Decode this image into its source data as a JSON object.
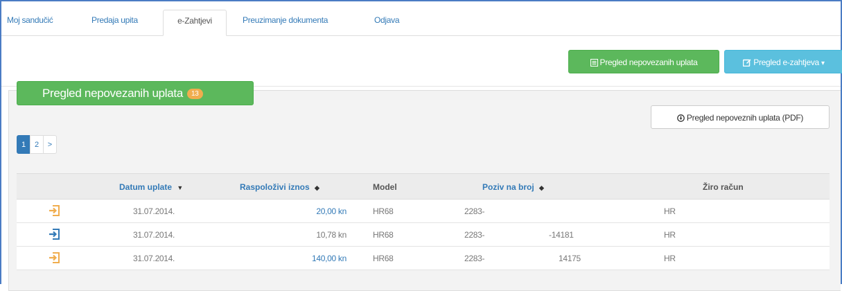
{
  "tabs": [
    {
      "label": "Moj sandučić"
    },
    {
      "label": "Predaja upita"
    },
    {
      "label": "e-Zahtjevi",
      "active": true
    },
    {
      "label": "Preuzimanje dokumenta"
    },
    {
      "label": "Odjava"
    }
  ],
  "actions": {
    "unlinked_label": "Pregled nepovezanih uplata",
    "requests_label": "Pregled e-zahtjeva",
    "requests_caret": "▾"
  },
  "panel": {
    "title": "Pregled nepovezanih uplata",
    "badge": "13",
    "pdf_label": "Pregled nepoveznih uplata (PDF)"
  },
  "pagination": {
    "pages": [
      "1",
      "2"
    ],
    "next": ">",
    "active": "1"
  },
  "table": {
    "columns": {
      "date": "Datum uplate",
      "amount": "Raspoloživi iznos",
      "model": "Model",
      "reference": "Poziv na broj",
      "account": "Žiro račun"
    },
    "sort_desc_icon": "▼",
    "sort_both_icon": "◆",
    "rows": [
      {
        "date": "31.07.2014.",
        "amount": "20,00 kn",
        "amount_link": true,
        "model": "HR68",
        "ref1": "2283-",
        "ref2": "",
        "account": "HR",
        "icon_color": "#f0ad4e"
      },
      {
        "date": "31.07.2014.",
        "amount": "10,78 kn",
        "amount_link": false,
        "model": "HR68",
        "ref1": "2283-",
        "ref2": "-14181",
        "account": "HR",
        "icon_color": "#337ab7"
      },
      {
        "date": "31.07.2014.",
        "amount": "140,00 kn",
        "amount_link": true,
        "model": "HR68",
        "ref1": "2283-",
        "ref2": "14175",
        "account": "HR",
        "icon_color": "#f0ad4e"
      }
    ]
  },
  "colors": {
    "accent": "#337ab7",
    "green": "#5cb85c",
    "info": "#5bc0de",
    "warning": "#f0ad4e",
    "frame": "#4a7cc4"
  }
}
